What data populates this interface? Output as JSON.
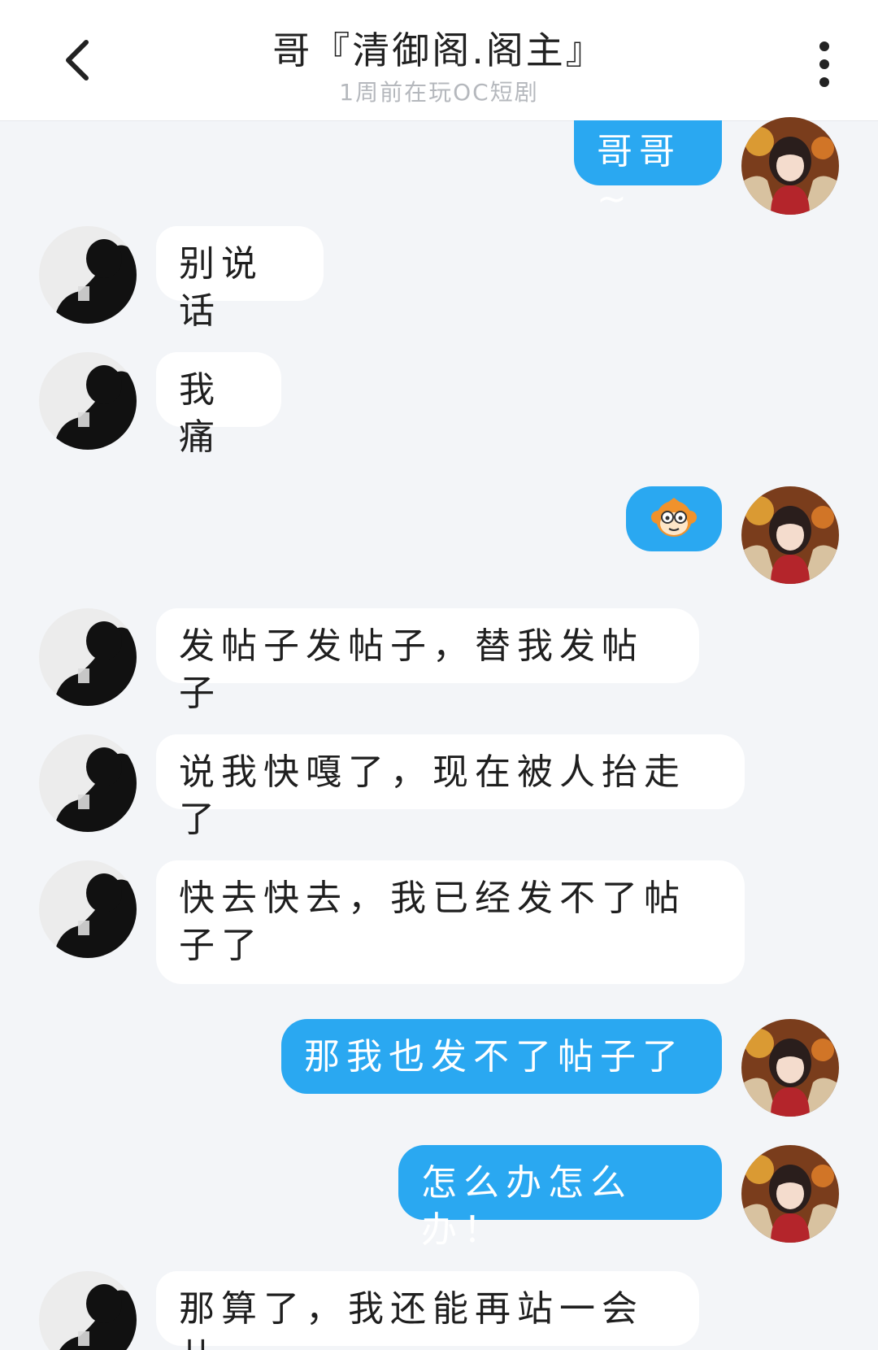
{
  "header": {
    "title": "哥『清御阁.阁主』",
    "subtitle": "1周前在玩OC短剧"
  },
  "messages": [
    {
      "side": "out",
      "text": "哥哥~"
    },
    {
      "side": "in",
      "text": "别说话"
    },
    {
      "side": "in",
      "text": "我痛"
    },
    {
      "side": "out",
      "type": "emoji",
      "icon": "monkey-face-icon"
    },
    {
      "side": "in",
      "text": "发帖子发帖子，替我发帖子"
    },
    {
      "side": "in",
      "text": "说我快嘎了，现在被人抬走了"
    },
    {
      "side": "in",
      "text": "快去快去，我已经发不了帖子了"
    },
    {
      "side": "out",
      "text": "那我也发不了帖子了"
    },
    {
      "side": "out",
      "text": "怎么办怎么办！"
    },
    {
      "side": "in",
      "text": "那算了，我还能再站一会儿"
    }
  ],
  "colors": {
    "background": "#f3f5f8",
    "outgoing_bubble": "#2aa8f1",
    "incoming_bubble": "#ffffff",
    "accent": "#f0922c"
  }
}
